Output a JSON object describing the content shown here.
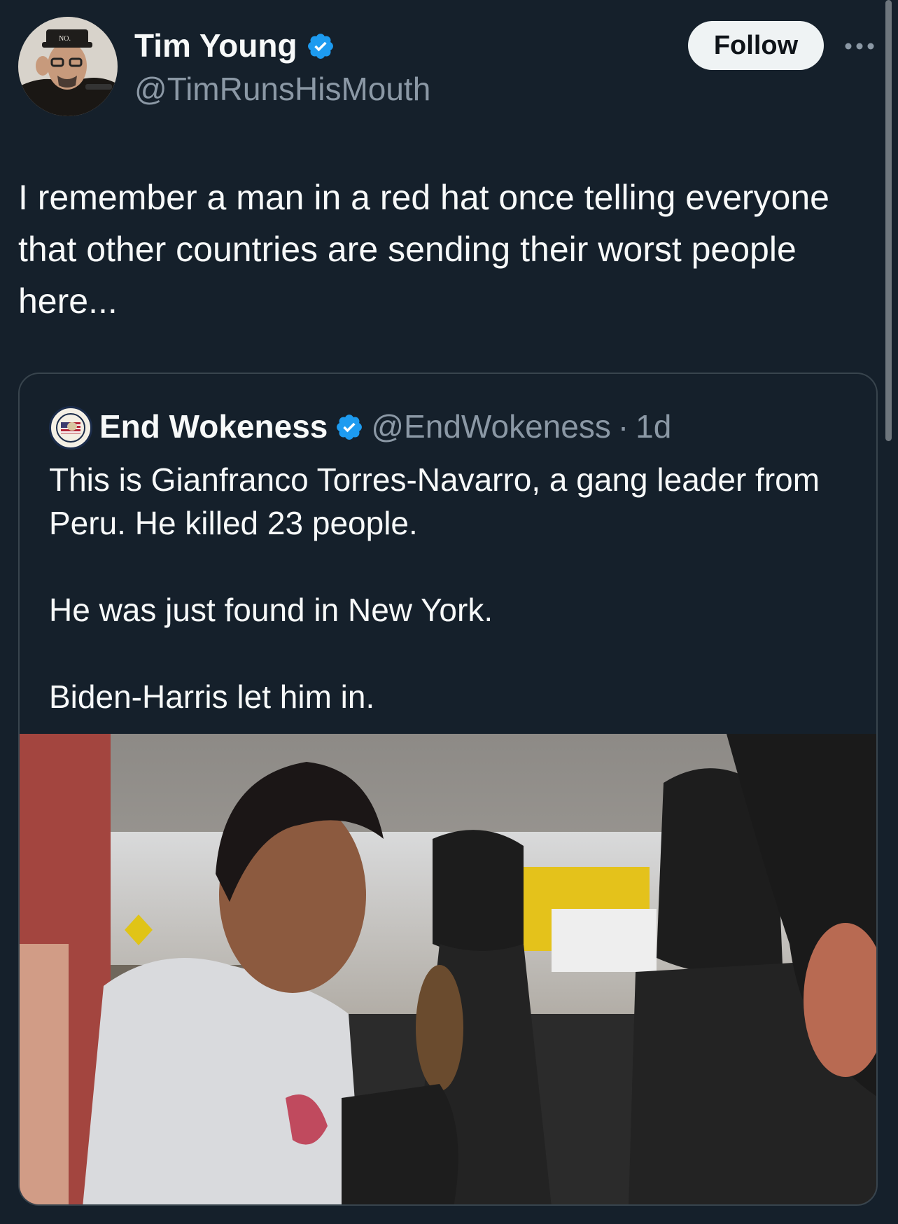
{
  "post": {
    "author_name": "Tim Young",
    "author_handle": "@TimRunsHisMouth",
    "follow_label": "Follow",
    "more_label": "•••",
    "text": "I remember a man in a red hat once telling everyone that other countries are sending their worst people here..."
  },
  "quote": {
    "author_name": "End Wokeness",
    "author_handle": "@EndWokeness",
    "separator": "·",
    "time": "1d",
    "paragraphs": [
      "This is Gianfranco Torres-Navarro, a gang leader from Peru. He killed 23 people.",
      "He was just found in New York.",
      "Biden-Harris let him in."
    ],
    "photo_icon": "photo-of-man-in-car"
  },
  "colors": {
    "background": "#15202b",
    "verified": "#1d9bf0",
    "secondary_text": "#8b98a5",
    "border": "#38444d"
  }
}
